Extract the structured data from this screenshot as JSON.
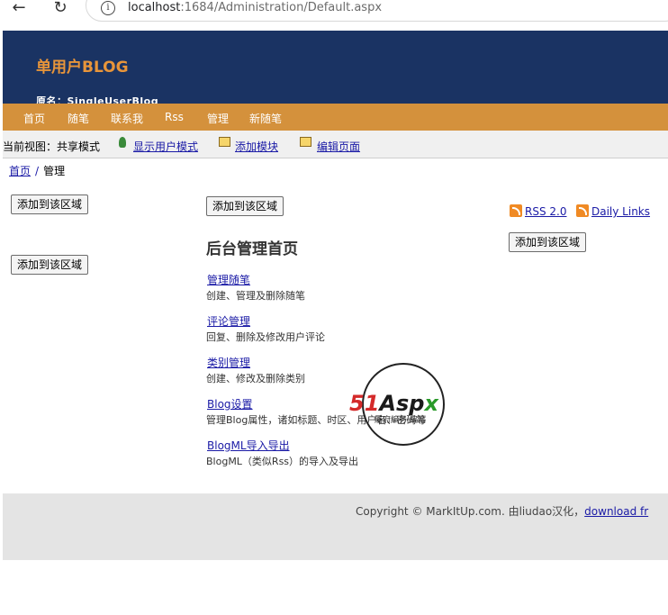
{
  "browser": {
    "url_host": "localhost",
    "url_path": ":1684/Administration/Default.aspx"
  },
  "header": {
    "title": "单用户BLOG",
    "original_name": "原名：SingleUserBlog"
  },
  "menu": [
    "首页",
    "随笔",
    "联系我",
    "Rss",
    "管理",
    "新随笔"
  ],
  "viewbar": {
    "label": "当前视图：共享模式",
    "show_user_mode": "显示用户模式",
    "add_module": "添加模块",
    "edit_page": "编辑页面"
  },
  "breadcrumb": {
    "home": "首页",
    "separator": "/",
    "current": "管理"
  },
  "buttons": {
    "add_to_region": "添加到该区域"
  },
  "main": {
    "title": "后台管理首页",
    "entries": [
      {
        "link": "管理随笔",
        "desc": "创建、管理及删除随笔"
      },
      {
        "link": "评论管理",
        "desc": "回复、删除及修改用户评论"
      },
      {
        "link": "类别管理",
        "desc": "创建、修改及删除类别"
      },
      {
        "link": "Blog设置",
        "desc": "管理Blog属性，诸如标题、时区、用户名、密码等"
      },
      {
        "link": "BlogML导入导出",
        "desc": "BlogML（类似Rss）的导入及导出"
      }
    ]
  },
  "right": {
    "rss_label": "RSS 2.0",
    "daily_label": "Daily Links"
  },
  "footer": {
    "copyright": "Copyright © MarkItUp.com.   由liudao汉化，",
    "download": "download fr"
  },
  "watermark": {
    "part1": "51",
    "part2": "Asp",
    "part3": "x",
    "sub": "屬府編务 編站"
  },
  "colors": {
    "header_bg": "#1a3363",
    "title_orange": "#e8953a",
    "menu_bg": "#d4913c",
    "link_blue": "#1a1aa6",
    "footer_bg": "#e4e4e4"
  }
}
